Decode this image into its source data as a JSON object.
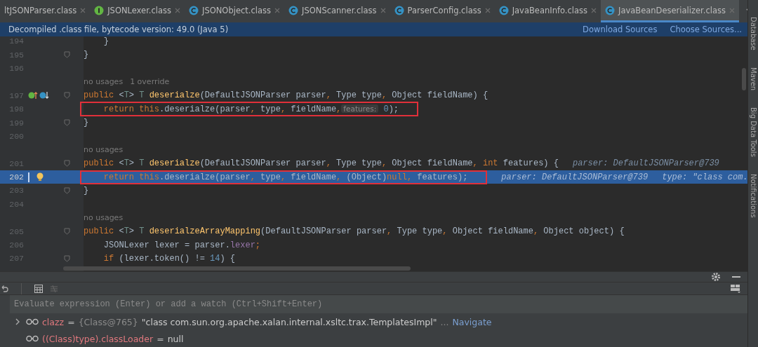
{
  "tabs": [
    {
      "label": "ltJSONParser.class",
      "kind": "plain",
      "selected": false
    },
    {
      "label": "JSONLexer.class",
      "kind": "interface",
      "selected": false
    },
    {
      "label": "JSONObject.class",
      "kind": "class",
      "selected": false
    },
    {
      "label": "JSONScanner.class",
      "kind": "class",
      "selected": false
    },
    {
      "label": "ParserConfig.class",
      "kind": "class",
      "selected": false
    },
    {
      "label": "JavaBeanInfo.class",
      "kind": "class",
      "selected": false
    },
    {
      "label": "JavaBeanDeserializer.class",
      "kind": "class",
      "selected": true
    }
  ],
  "banner": {
    "text": "Decompiled .class file, bytecode version: 49.0 (Java 5)",
    "links": [
      "Download Sources",
      "Choose Sources..."
    ]
  },
  "editor": {
    "lines": [
      {
        "kind": "code",
        "number": "194",
        "fold": false,
        "tokens": [
          {
            "kind": "txt",
            "text": "    }"
          }
        ]
      },
      {
        "kind": "code",
        "number": "195",
        "fold": true,
        "tokens": [
          {
            "kind": "txt",
            "text": "}"
          }
        ]
      },
      {
        "kind": "code",
        "number": "196",
        "fold": false
      },
      {
        "kind": "hint",
        "texts": [
          "no usages",
          "1 override"
        ]
      },
      {
        "kind": "code",
        "number": "197",
        "fold": true,
        "markers": [
          {
            "kind": "override"
          },
          {
            "kind": "implemented"
          }
        ],
        "tokens": [
          {
            "kind": "kw",
            "text": "public"
          },
          {
            "kind": "txt",
            "text": " <"
          },
          {
            "kind": "tp",
            "text": "T"
          },
          {
            "kind": "txt",
            "text": "> "
          },
          {
            "kind": "tp",
            "text": "T"
          },
          {
            "kind": "fn",
            "text": " deserialze"
          },
          {
            "kind": "txt",
            "text": "(DefaultJSONParser parser"
          },
          {
            "kind": "kw",
            "text": ","
          },
          {
            "kind": "txt",
            "text": " Type type"
          },
          {
            "kind": "kw",
            "text": ","
          },
          {
            "kind": "txt",
            "text": " Object fieldName) {"
          }
        ]
      },
      {
        "kind": "code",
        "number": "198",
        "fold": false,
        "boxed": true,
        "tokens": [
          {
            "kind": "kw",
            "text": "    return this"
          },
          {
            "kind": "txt",
            "text": ".deserialze(parser"
          },
          {
            "kind": "kw",
            "text": ","
          },
          {
            "kind": "txt",
            "text": " type"
          },
          {
            "kind": "kw",
            "text": ","
          },
          {
            "kind": "txt",
            "text": " fieldName"
          },
          {
            "kind": "kw",
            "text": ","
          },
          {
            "kind": "inlay",
            "text": "features:"
          },
          {
            "kind": "num",
            "text": " 0"
          },
          {
            "kind": "txt",
            "text": ");"
          }
        ]
      },
      {
        "kind": "code",
        "number": "199",
        "fold": true,
        "tokens": [
          {
            "kind": "txt",
            "text": "}"
          }
        ]
      },
      {
        "kind": "code",
        "number": "200",
        "fold": false
      },
      {
        "kind": "hint",
        "texts": [
          "no usages"
        ]
      },
      {
        "kind": "code",
        "number": "201",
        "fold": true,
        "tokens": [
          {
            "kind": "kw",
            "text": "public"
          },
          {
            "kind": "txt",
            "text": " <"
          },
          {
            "kind": "tp",
            "text": "T"
          },
          {
            "kind": "txt",
            "text": "> "
          },
          {
            "kind": "tp",
            "text": "T"
          },
          {
            "kind": "fn",
            "text": " deserialze"
          },
          {
            "kind": "txt",
            "text": "(DefaultJSONParser parser"
          },
          {
            "kind": "kw",
            "text": ","
          },
          {
            "kind": "txt",
            "text": " Type type"
          },
          {
            "kind": "kw",
            "text": ","
          },
          {
            "kind": "txt",
            "text": " Object fieldName"
          },
          {
            "kind": "kw",
            "text": ","
          },
          {
            "kind": "kw",
            "text": " int"
          },
          {
            "kind": "txt",
            "text": " features) {"
          }
        ],
        "debug": [
          "parser: DefaultJSONParser@739"
        ]
      },
      {
        "kind": "code",
        "number": "202",
        "fold": false,
        "current": true,
        "boxed": true,
        "markers": [
          {
            "kind": "bulb"
          }
        ],
        "tokens": [
          {
            "kind": "kw",
            "text": "    return this"
          },
          {
            "kind": "txt",
            "text": ".deserialze(parser"
          },
          {
            "kind": "kw",
            "text": ","
          },
          {
            "kind": "txt",
            "text": " type"
          },
          {
            "kind": "kw",
            "text": ","
          },
          {
            "kind": "txt",
            "text": " fieldName"
          },
          {
            "kind": "kw",
            "text": ","
          },
          {
            "kind": "txt",
            "text": " (Object)"
          },
          {
            "kind": "kw",
            "text": "null,"
          },
          {
            "kind": "txt",
            "text": " features);"
          }
        ],
        "debug": [
          "parser: DefaultJSONParser@739",
          "type: \"class com."
        ]
      },
      {
        "kind": "code",
        "number": "203",
        "fold": true,
        "tokens": [
          {
            "kind": "txt",
            "text": "}"
          }
        ]
      },
      {
        "kind": "code",
        "number": "204",
        "fold": false
      },
      {
        "kind": "hint",
        "texts": [
          "no usages"
        ]
      },
      {
        "kind": "code",
        "number": "205",
        "fold": true,
        "tokens": [
          {
            "kind": "kw",
            "text": "public"
          },
          {
            "kind": "txt",
            "text": " <"
          },
          {
            "kind": "tp",
            "text": "T"
          },
          {
            "kind": "txt",
            "text": "> "
          },
          {
            "kind": "tp",
            "text": "T"
          },
          {
            "kind": "fn",
            "text": " deserialzeArrayMapping"
          },
          {
            "kind": "txt",
            "text": "(DefaultJSONParser parser"
          },
          {
            "kind": "kw",
            "text": ","
          },
          {
            "kind": "txt",
            "text": " Type type"
          },
          {
            "kind": "kw",
            "text": ","
          },
          {
            "kind": "txt",
            "text": " Object fieldName"
          },
          {
            "kind": "kw",
            "text": ","
          },
          {
            "kind": "txt",
            "text": " Object object) {"
          }
        ]
      },
      {
        "kind": "code",
        "number": "206",
        "fold": false,
        "tokens": [
          {
            "kind": "txt",
            "text": "    JSONLexer lexer = parser."
          },
          {
            "kind": "field",
            "text": "lexer"
          },
          {
            "kind": "kw",
            "text": ";"
          }
        ]
      },
      {
        "kind": "code",
        "number": "207",
        "fold": true,
        "tokens": [
          {
            "kind": "kw",
            "text": "    if"
          },
          {
            "kind": "txt",
            "text": " (lexer.token() !="
          },
          {
            "kind": "num",
            "text": " 14"
          },
          {
            "kind": "txt",
            "text": ") {"
          }
        ]
      }
    ]
  },
  "sidebar": [
    "Database",
    "Maven",
    "Big Data Tools",
    "Notifications"
  ],
  "debugger": {
    "evaluate": {
      "placeholder": "Evaluate expression (Enter) or add a watch (Ctrl+Shift+Enter)"
    },
    "variables": [
      {
        "name": "clazz",
        "operator": "=",
        "ref": "{Class@765}",
        "value": "\"class com.sun.org.apache.xalan.internal.xsltc.trax.TemplatesImpl\"",
        "more": "...",
        "link": "Navigate",
        "expandable": true
      },
      {
        "name": "((Class)type).classLoader",
        "operator": "=",
        "value": "null",
        "expandable": false
      }
    ]
  }
}
